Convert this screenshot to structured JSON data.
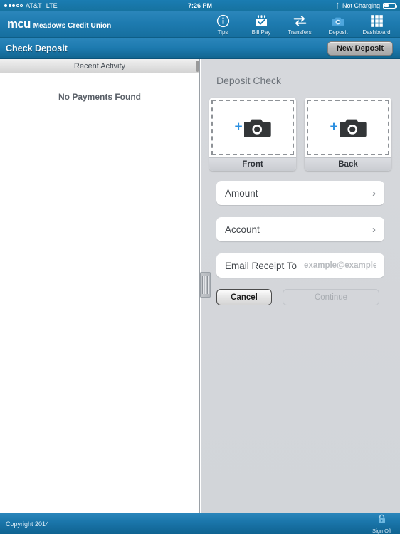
{
  "statusbar": {
    "carrier": "AT&T",
    "network": "LTE",
    "time": "7:26 PM",
    "bluetooth_icon": "bluetooth-icon",
    "charging_status": "Not Charging",
    "battery_icon": "battery-icon",
    "signal_dots_filled": 3,
    "signal_dots_empty": 2
  },
  "navbar": {
    "brand_short": "mcu",
    "brand_name": "Meadows Credit Union",
    "items": [
      {
        "label": "Tips",
        "icon": "info-circle-icon",
        "active": false
      },
      {
        "label": "Bill Pay",
        "icon": "calendar-check-icon",
        "active": false
      },
      {
        "label": "Transfers",
        "icon": "transfer-arrows-icon",
        "active": false
      },
      {
        "label": "Deposit",
        "icon": "camera-icon",
        "active": true
      },
      {
        "label": "Dashboard",
        "icon": "grid-icon",
        "active": false
      }
    ]
  },
  "titlebar": {
    "title": "Check Deposit",
    "new_deposit_label": "New Deposit"
  },
  "left_pane": {
    "header": "Recent Activity",
    "empty_message": "No Payments Found"
  },
  "right_pane": {
    "heading": "Deposit Check",
    "captures": [
      {
        "label": "Front",
        "icon": "camera-add-icon"
      },
      {
        "label": "Back",
        "icon": "camera-add-icon"
      }
    ],
    "fields": [
      {
        "label": "Amount",
        "chevron": "›"
      },
      {
        "label": "Account",
        "chevron": "›"
      }
    ],
    "email": {
      "label": "Email Receipt To",
      "value": "",
      "placeholder": "example@example.com"
    },
    "buttons": {
      "cancel": "Cancel",
      "continue": "Continue"
    }
  },
  "footer": {
    "copyright": "Copyright 2014",
    "signoff_label": "Sign Off",
    "signoff_icon": "lock-icon"
  },
  "colors": {
    "brand_blue": "#1e7bb0",
    "brand_blue_dark": "#0f6391",
    "accent_plus": "#2b8fe0",
    "panel_gray": "#d4d7db",
    "text_dark": "#2d3137"
  }
}
